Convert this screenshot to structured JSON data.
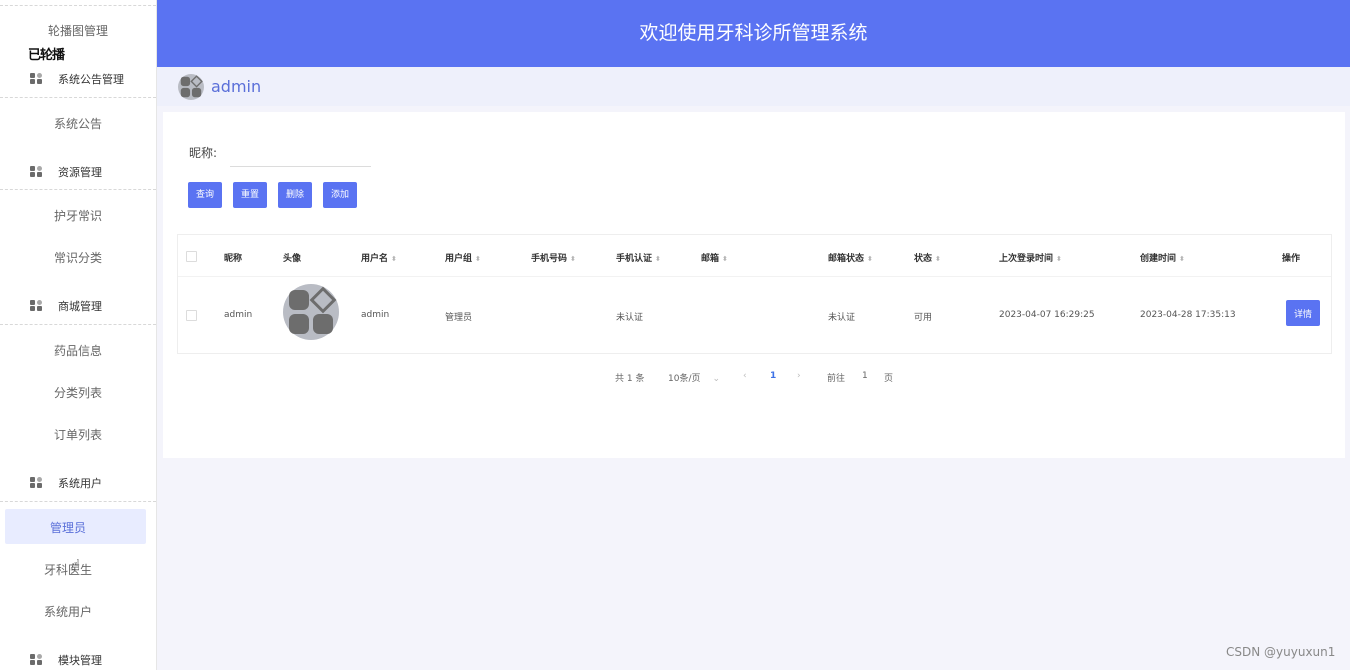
{
  "sidebar": {
    "top_item": "轮播图管理",
    "glitch_text": "已轮播",
    "groups": [
      {
        "label": "系统公告管理",
        "items": [
          "系统公告"
        ]
      },
      {
        "label": "资源管理",
        "items": [
          "护牙常识",
          "常识分类"
        ]
      },
      {
        "label": "商城管理",
        "items": [
          "药品信息",
          "分类列表",
          "订单列表"
        ]
      },
      {
        "label": "系统用户",
        "items": [
          "管理员",
          "牙科医生",
          "系统用户"
        ]
      },
      {
        "label": "模块管理",
        "items": []
      }
    ],
    "active_item": "管理员"
  },
  "header": {
    "title": "欢迎使用牙科诊所管理系统",
    "username": "admin"
  },
  "filter": {
    "label": "昵称:",
    "value": "",
    "placeholder": ""
  },
  "actions": {
    "query": "查询",
    "reset": "重置",
    "delete": "删除",
    "add": "添加"
  },
  "table": {
    "columns": [
      "昵称",
      "头像",
      "用户名",
      "用户组",
      "手机号码",
      "手机认证",
      "邮箱",
      "邮箱状态",
      "状态",
      "上次登录时间",
      "创建时间",
      "操作"
    ],
    "rows": [
      {
        "nickname": "admin",
        "username": "admin",
        "group": "管理员",
        "phone": "",
        "phone_verified": "未认证",
        "email": "",
        "email_status": "未认证",
        "status": "可用",
        "last_login": "2023-04-07 16:29:25",
        "created": "2023-04-28 17:35:13",
        "action": "详情"
      }
    ]
  },
  "pagination": {
    "total": "共 1 条",
    "page_size": "10条/页",
    "current": "1",
    "goto_prefix": "前往",
    "goto_value": "1",
    "goto_suffix": "页"
  },
  "watermark": "CSDN @yuyuxun1",
  "colors": {
    "primary": "#5a73f2",
    "header_bg": "#5a73f2",
    "page_bg": "#f4f4fb",
    "active_bg": "#e8ecff"
  }
}
